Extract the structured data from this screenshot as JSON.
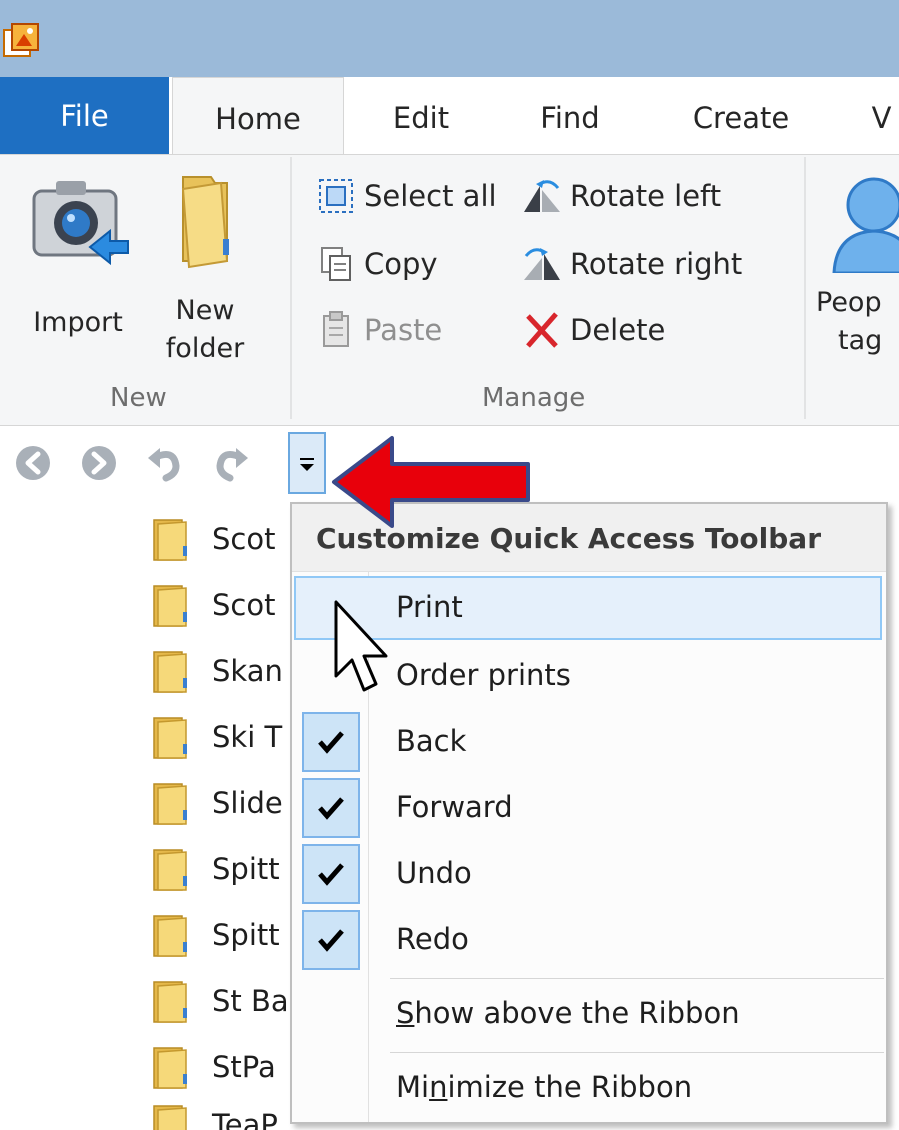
{
  "tabs": [
    {
      "label": "File"
    },
    {
      "label": "Home"
    },
    {
      "label": "Edit"
    },
    {
      "label": "Find"
    },
    {
      "label": "Create"
    },
    {
      "label": "V"
    }
  ],
  "ribbon": {
    "new_group": {
      "label": "New",
      "import_label": "Import",
      "new_folder_line1": "New",
      "new_folder_line2": "folder"
    },
    "manage_group": {
      "label": "Manage",
      "select_all": "Select all",
      "copy": "Copy",
      "paste": "Paste",
      "rotate_left": "Rotate left",
      "rotate_right": "Rotate right",
      "delete": "Delete"
    },
    "people_tag": {
      "line1": "Peop",
      "line2": "tag"
    }
  },
  "file_list": [
    {
      "name": "Scot"
    },
    {
      "name": "Scot"
    },
    {
      "name": "Skan"
    },
    {
      "name": "Ski T"
    },
    {
      "name": "Slide"
    },
    {
      "name": "Spitt"
    },
    {
      "name": "Spitt"
    },
    {
      "name": "St Ba"
    },
    {
      "name": "StPa"
    },
    {
      "name": "TeaP"
    }
  ],
  "menu": {
    "title": "Customize Quick Access Toolbar",
    "items": [
      {
        "label": "Print",
        "checked": false
      },
      {
        "label": "Order prints",
        "checked": false
      },
      {
        "label": "Back",
        "checked": true
      },
      {
        "label": "Forward",
        "checked": true
      },
      {
        "label": "Undo",
        "checked": true
      },
      {
        "label": "Redo",
        "checked": true
      }
    ],
    "show_above": {
      "pre": "",
      "key": "S",
      "post": "how above the Ribbon"
    },
    "minimize": {
      "pre": "Mi",
      "key": "n",
      "post": "imize the Ribbon"
    }
  },
  "colors": {
    "title_bar": "#9bbad9",
    "file_tab": "#1e6fc2",
    "arrow": "#e8000b",
    "hover_item": "#e5f0fb"
  }
}
